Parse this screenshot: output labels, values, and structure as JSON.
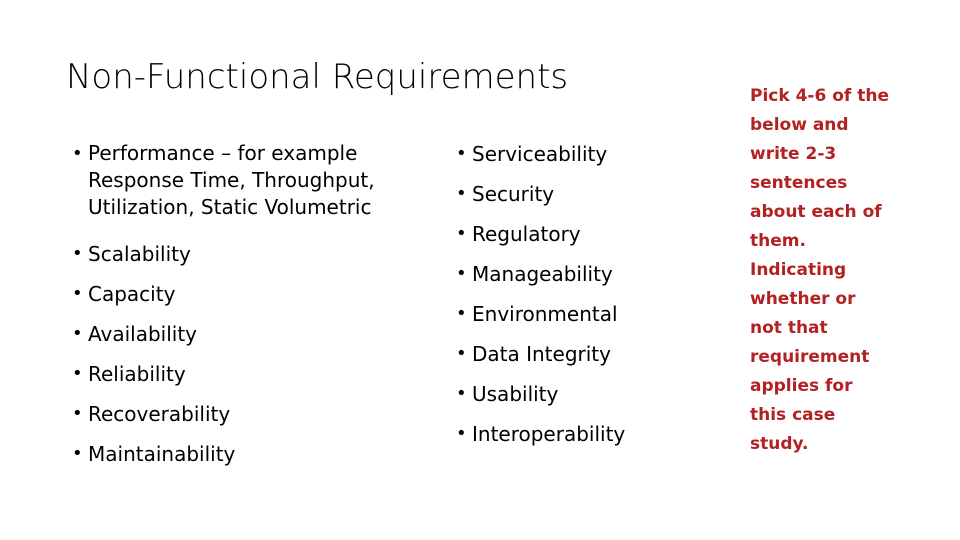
{
  "slide": {
    "title": "Non-Functional Requirements",
    "background_color": "#FFFFFF",
    "text_color": "#000000",
    "accent_color": "#B32222",
    "bullet_glyph": "•"
  },
  "left_column": {
    "items": [
      {
        "lines": [
          "Performance – for example",
          "Response Time, Throughput,",
          "Utilization, Static Volumetric"
        ],
        "multiline": true
      },
      {
        "lines": [
          "Scalability"
        ],
        "multiline": false
      },
      {
        "lines": [
          "Capacity"
        ],
        "multiline": false
      },
      {
        "lines": [
          "Availability"
        ],
        "multiline": false
      },
      {
        "lines": [
          "Reliability"
        ],
        "multiline": false
      },
      {
        "lines": [
          "Recoverability"
        ],
        "multiline": false
      },
      {
        "lines": [
          "Maintainability"
        ],
        "multiline": false
      }
    ]
  },
  "middle_column": {
    "items": [
      {
        "lines": [
          "Serviceability"
        ],
        "multiline": false
      },
      {
        "lines": [
          "Security"
        ],
        "multiline": false
      },
      {
        "lines": [
          "Regulatory"
        ],
        "multiline": false
      },
      {
        "lines": [
          "Manageability"
        ],
        "multiline": false
      },
      {
        "lines": [
          "Environmental"
        ],
        "multiline": false
      },
      {
        "lines": [
          "Data Integrity"
        ],
        "multiline": false
      },
      {
        "lines": [
          "Usability"
        ],
        "multiline": false
      },
      {
        "lines": [
          "Interoperability"
        ],
        "multiline": false
      }
    ]
  },
  "note_column": {
    "color": "#B32222",
    "lines": [
      "Pick 4-6 of the",
      "below and",
      "write 2-3",
      "sentences",
      "about each of",
      "them.",
      "Indicating",
      "whether or",
      "not that",
      "requirement",
      "applies for",
      "this case",
      "study."
    ]
  }
}
